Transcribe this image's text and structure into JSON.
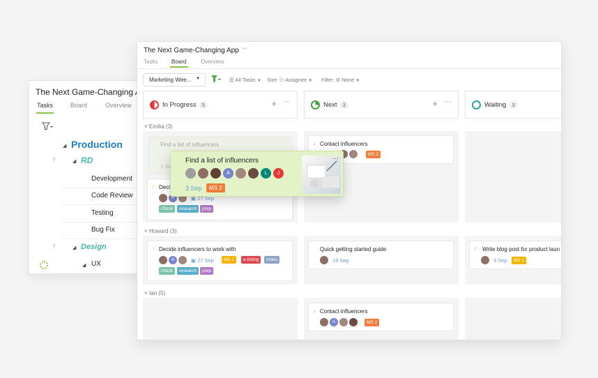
{
  "back_panel": {
    "title": "The Next Game-Changing App",
    "tabs": [
      "Tasks",
      "Board",
      "Overview"
    ],
    "tree": [
      {
        "label": "Production",
        "level": 0
      },
      {
        "label": "RD",
        "level": 1
      },
      {
        "label": "Development",
        "level": 2
      },
      {
        "label": "Code Review",
        "level": 2
      },
      {
        "label": "Testing",
        "level": 2
      },
      {
        "label": "Bug Fix",
        "level": 2
      },
      {
        "label": "Design",
        "level": 1
      },
      {
        "label": "UX",
        "level": 2
      }
    ]
  },
  "board": {
    "title": "The Next Game-Changing App",
    "tabs": [
      "Tasks",
      "Board",
      "Overview"
    ],
    "active_tab": "Board",
    "toolbar": {
      "view_select": "Marketing Wee...",
      "all_tasks": "All Tasks",
      "sort": "Sort:",
      "sort_value": "Assignee",
      "filter": "Filter:",
      "filter_value": "None"
    },
    "columns": [
      {
        "name": "In Progress",
        "count": "5",
        "status_color": "#e53935"
      },
      {
        "name": "Next",
        "count": "3",
        "status_color": "#43a047"
      },
      {
        "name": "Waiting",
        "count": "3",
        "status_color": "#26a69a"
      }
    ],
    "groups": [
      {
        "name": "Emilia",
        "count": "(3)"
      },
      {
        "name": "Howard",
        "count": "(3)"
      },
      {
        "name": "Ian",
        "count": "(5)"
      }
    ],
    "cards": {
      "ghost": {
        "title": "Find a list of influencers",
        "date": "3 Se"
      },
      "decide1": {
        "title": "Decide",
        "date": "27 Sep",
        "tags": [
          "check",
          "research",
          "prep"
        ]
      },
      "contact1": {
        "title": "Contact influencers",
        "ms": "MS 2"
      },
      "decide2": {
        "title": "Decide influencers to work with",
        "date": "27 Sep",
        "ms": "MS 1",
        "tags": [
          "e-listing",
          "notes",
          "check",
          "research",
          "prep"
        ]
      },
      "guide": {
        "title": "Quick getting started guide",
        "date": "19 Sep"
      },
      "blog": {
        "title": "Write blog post for product laun",
        "date": "3 Sep",
        "ms": "MS 1"
      },
      "contact2": {
        "title": "Contact influencers",
        "ms": "MS 2"
      }
    }
  },
  "drag_card": {
    "title": "Find a list of influencers",
    "date": "3 Sep",
    "ms": "MS 2",
    "avatars": [
      "",
      "",
      "",
      "A",
      "",
      "",
      "L",
      "J"
    ]
  },
  "colors": {
    "accent": "#8bc34a",
    "ms1": "#f4b400",
    "ms2": "#ef7d3c",
    "tag_check": "#7bc4a8",
    "tag_research": "#5aaecb",
    "tag_prep": "#b27bc4",
    "tag_elisting": "#e0474c",
    "tag_notes": "#8fa3c7"
  }
}
